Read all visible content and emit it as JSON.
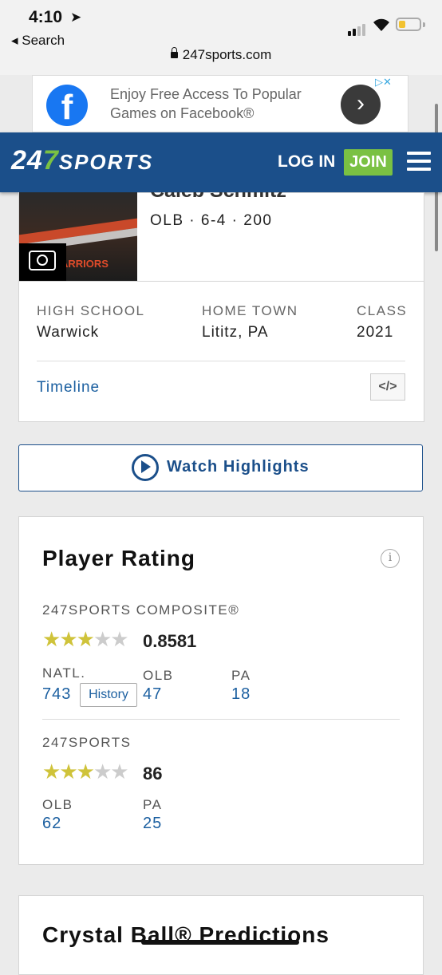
{
  "status_bar": {
    "time": "4:10",
    "back_label": "◂ Search",
    "url": "247sports.com",
    "battery_level": 0.35
  },
  "ad": {
    "text": "Enjoy Free Access To Popular Games on Facebook®",
    "brand_icon": "facebook-icon",
    "accent": "#1877f2"
  },
  "nav": {
    "logo_num": "24",
    "logo_seven": "7",
    "logo_sports": "SPORTS",
    "login_label": "LOG IN",
    "join_label": "JOIN",
    "menu_icon": "hamburger-icon",
    "brand_color": "#1b4f8a",
    "join_color": "#7ac143"
  },
  "player": {
    "name_partial": "Caleb Schmitz",
    "position_line": "OLB · 6-4 · 200",
    "photo_text": "ARRIORS",
    "high_school_label": "HIGH SCHOOL",
    "high_school": "Warwick",
    "home_town_label": "HOME TOWN",
    "home_town": "Lititz, PA",
    "class_label": "CLASS",
    "class_year": "2021",
    "timeline_label": "Timeline",
    "embed_label": "</>"
  },
  "highlights": {
    "label": "Watch Highlights"
  },
  "rating": {
    "title": "Player Rating",
    "info_label": "i",
    "composite_label": "247SPORTS COMPOSITE®",
    "composite_stars": 3,
    "composite_score": "0.8581",
    "natl_label": "NATL.",
    "natl_rank": "743",
    "history_label": "History",
    "pos_label": "OLB",
    "pos_rank": "47",
    "state_label": "PA",
    "state_rank": "18",
    "sports_label": "247SPORTS",
    "sports_stars": 3,
    "sports_score": "86",
    "sports_pos_label": "OLB",
    "sports_pos_rank": "62",
    "sports_state_label": "PA",
    "sports_state_rank": "25",
    "star_color": "#cfc33a"
  },
  "crystal_ball": {
    "title": "Crystal Ball® Predictions"
  }
}
